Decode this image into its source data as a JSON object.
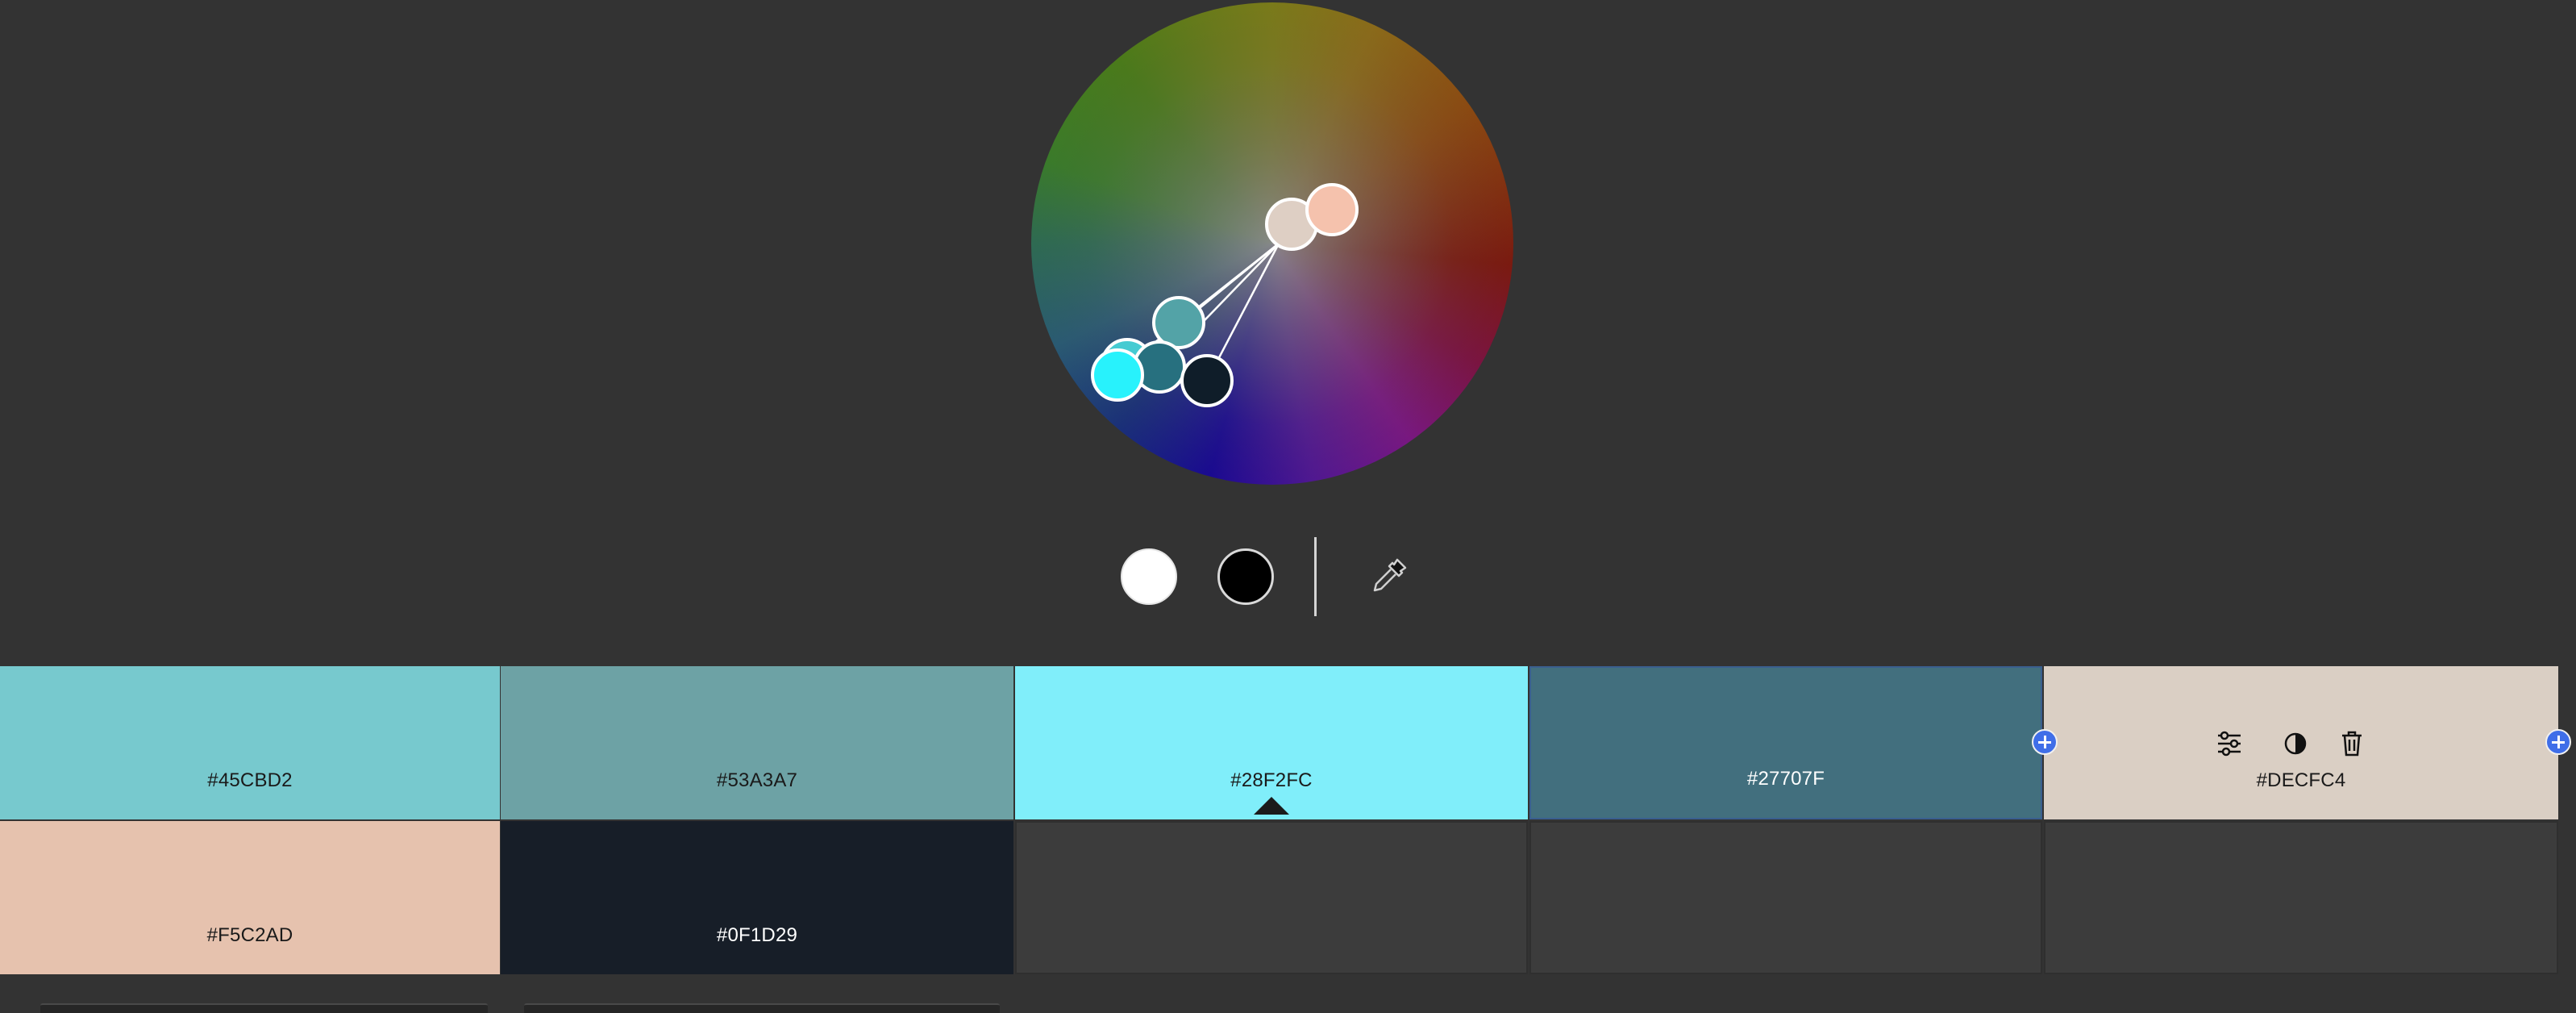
{
  "colors": {
    "background": "#333333",
    "empty_cell": "#3c3c3c",
    "accent": "#3f6ee8"
  },
  "wheel": {
    "handles": [
      {
        "name": "handle-1",
        "color": "#45CBD2"
      },
      {
        "name": "handle-2",
        "color": "#53A3A7"
      },
      {
        "name": "handle-3",
        "color": "#28F2FC"
      },
      {
        "name": "handle-4",
        "color": "#27707F"
      },
      {
        "name": "handle-5",
        "color": "#DECFC4"
      },
      {
        "name": "handle-6",
        "color": "#F5C2AD"
      },
      {
        "name": "handle-7",
        "color": "#0F1D29"
      }
    ]
  },
  "tools": {
    "white_label": "white",
    "black_label": "black",
    "eyedropper_icon": "eyedropper-icon"
  },
  "swatches": [
    {
      "hex": "#45CBD2",
      "bg": "#77c9ce",
      "text_color": "#1a1a1a",
      "selected": false
    },
    {
      "hex": "#53A3A7",
      "bg": "#6da2a5",
      "text_color": "#1a1a1a",
      "selected": false
    },
    {
      "hex": "#28F2FC",
      "bg": "#80eefa",
      "text_color": "#1a1a1a",
      "selected": true
    },
    {
      "hex": "#27707F",
      "bg": "#426f7e",
      "text_color": "#ffffff",
      "selected": false
    },
    {
      "hex": "#DECFC4",
      "bg": "#dacfc4",
      "text_color": "#1a1a1a",
      "selected": false,
      "hovered": true
    },
    {
      "hex": "#F5C2AD",
      "bg": "#e6c2ae",
      "text_color": "#1a1a1a",
      "selected": false
    },
    {
      "hex": "#0F1D29",
      "bg": "#171e28",
      "text_color": "#ffffff",
      "selected": false
    }
  ],
  "swatch_tools": {
    "adjust_icon": "sliders-icon",
    "contrast_icon": "contrast-icon",
    "delete_icon": "trash-icon"
  }
}
